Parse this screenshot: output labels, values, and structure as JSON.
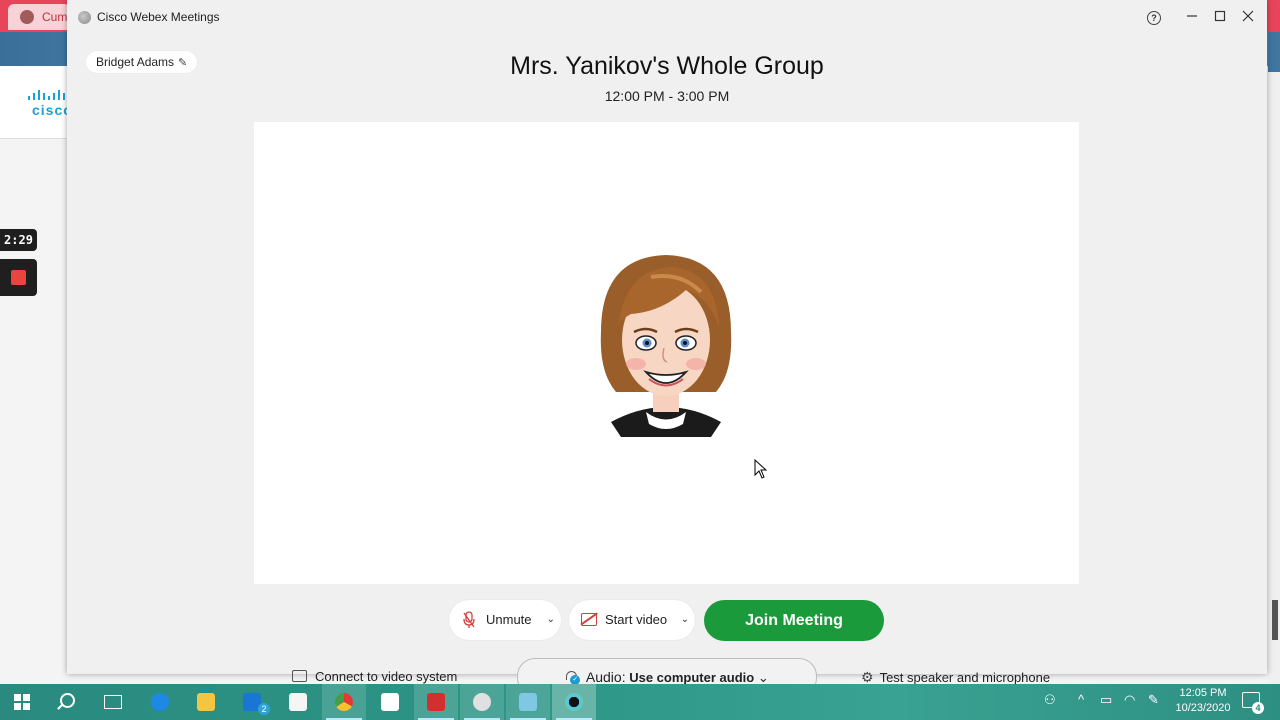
{
  "background": {
    "browser_tab_label": "Cuml",
    "logo_text": "cisco",
    "timer": "2:29"
  },
  "window": {
    "title": "Cisco Webex Meetings",
    "help_label": "?"
  },
  "user": {
    "name": "Bridget Adams",
    "edit_glyph": "✎"
  },
  "meeting": {
    "title": "Mrs. Yanikov's Whole Group",
    "time": "12:00 PM - 3:00 PM"
  },
  "controls": {
    "connect_label": "Connect to video system",
    "audio_prefix": "Audio:",
    "audio_value": "Use computer audio",
    "audio_chevron": "⌄",
    "test_label": "Test speaker and microphone",
    "gear_glyph": "⚙"
  },
  "actions": {
    "unmute_label": "Unmute",
    "mic_glyph": "🎙",
    "start_video_label": "Start video",
    "chevron": "⌄",
    "join_label": "Join Meeting"
  },
  "taskbar": {
    "mail_badge": "2",
    "clock_time": "12:05 PM",
    "clock_date": "10/23/2020",
    "notif_count": "4",
    "icons": [
      "windows-start-icon",
      "search-icon",
      "task-view-icon",
      "edge-icon",
      "file-explorer-icon",
      "mail-icon",
      "store-icon",
      "chrome-icon",
      "sticky-notes-icon",
      "acrobat-icon",
      "camera-app-icon",
      "notepad-icon",
      "webex-icon"
    ]
  },
  "colors": {
    "join_green": "#1a9a3a",
    "taskbar_teal": "#2a8a7f",
    "muted_red": "#d63d3d",
    "accent_blue": "#1ba0d7"
  }
}
